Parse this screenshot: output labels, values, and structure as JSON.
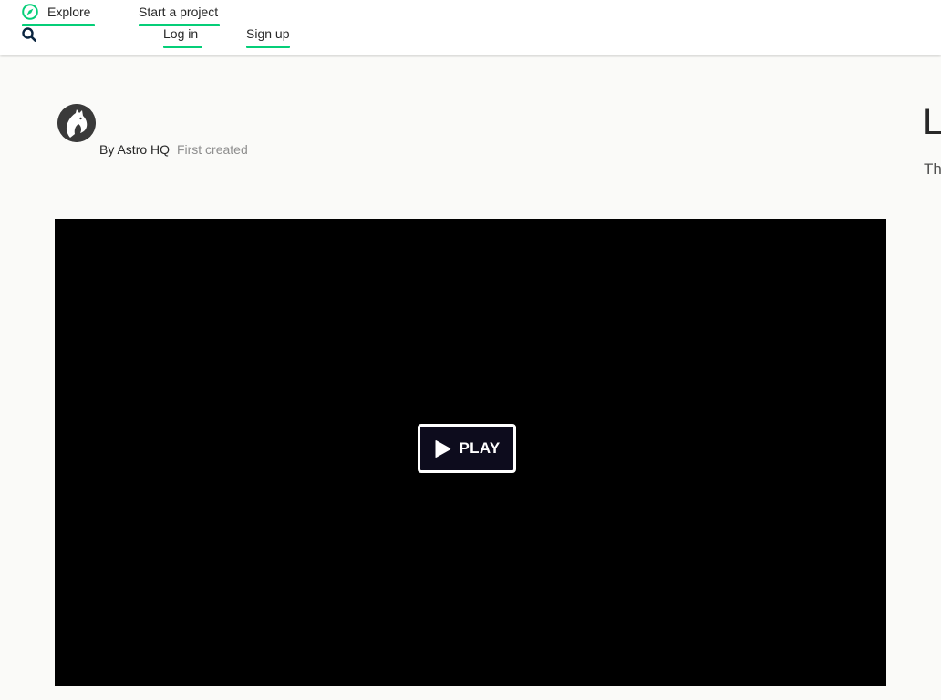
{
  "nav": {
    "explore_label": "Explore",
    "start_project_label": "Start a project",
    "login_label": "Log in",
    "signup_label": "Sign up",
    "accent_color": "#05ce78"
  },
  "icons": {
    "explore": "compass-icon",
    "search": "search-icon",
    "play": "play-icon"
  },
  "creator": {
    "by_label": "By",
    "name": "Astro HQ",
    "meta": "First created"
  },
  "project": {
    "title": "L",
    "blurb": "Th"
  },
  "video": {
    "play_label": "PLAY"
  }
}
